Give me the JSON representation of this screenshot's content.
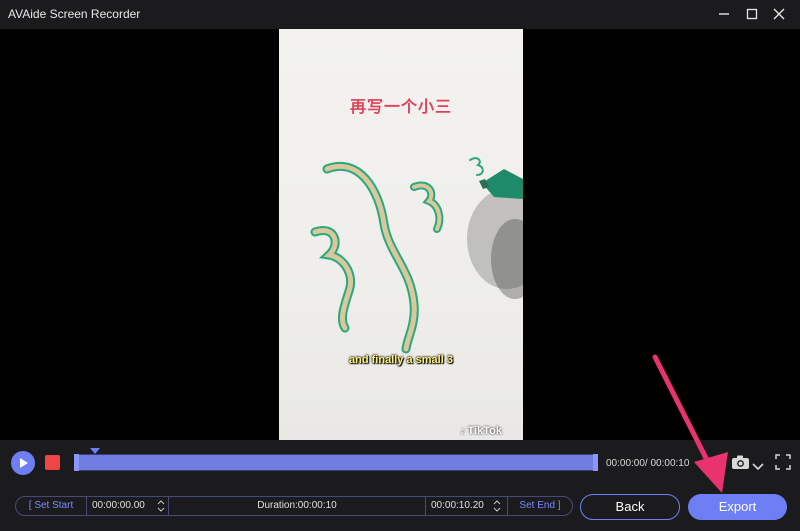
{
  "window": {
    "title": "AVAide Screen Recorder"
  },
  "video": {
    "caption_cn": "再写一个小三",
    "subtitle": "and finally a small 3",
    "watermark": "TikTok"
  },
  "controls": {
    "time_readout": "00:00:00/ 00:00:10"
  },
  "trim": {
    "set_start_label": "[ Set Start",
    "start_time": "00:00:00.00",
    "duration": "Duration:00:00:10",
    "end_time": "00:00:10.20",
    "set_end_label": "Set End ]"
  },
  "buttons": {
    "back_label": "Back",
    "export_label": "Export"
  },
  "colors": {
    "accent": "#6e7ff3",
    "stop": "#ee4545",
    "annotation_arrow": "#e8336e"
  }
}
